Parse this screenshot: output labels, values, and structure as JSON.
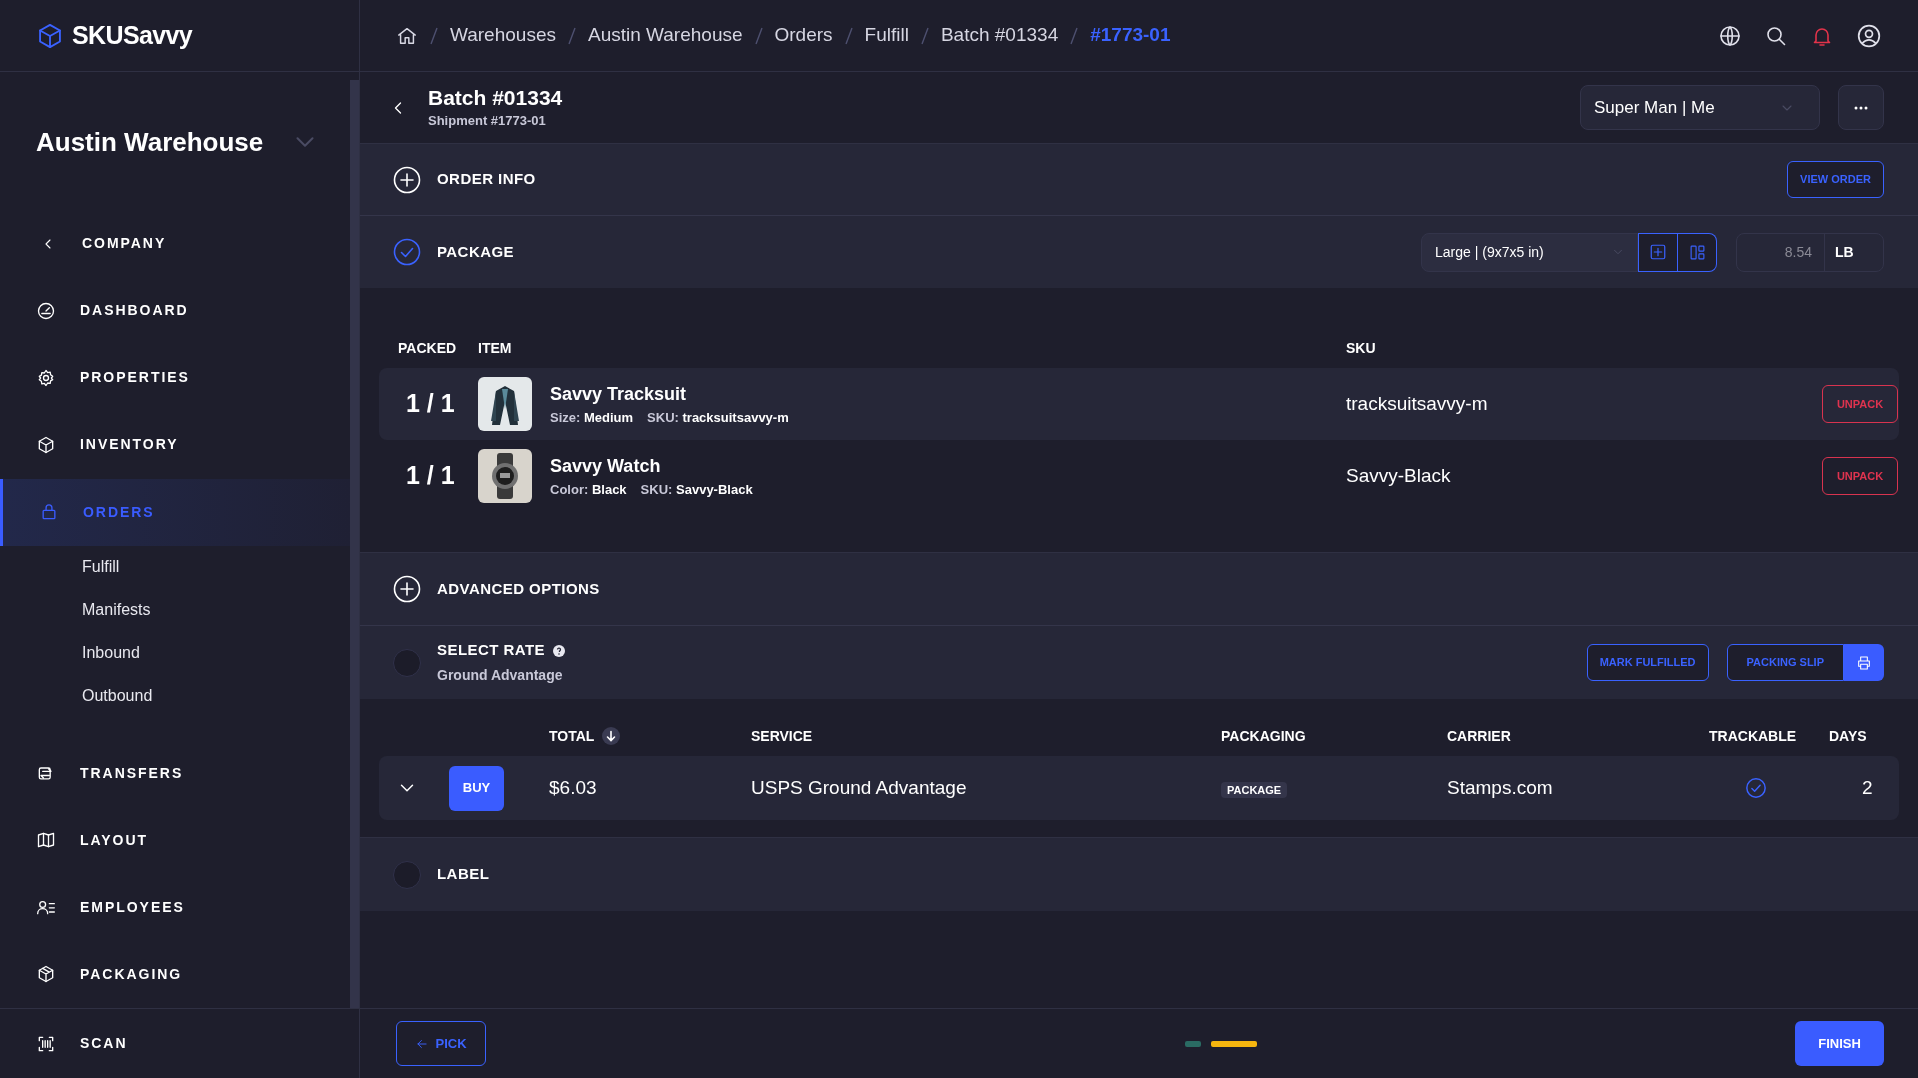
{
  "logo": {
    "text": "SKUSavvy"
  },
  "breadcrumbs": [
    {
      "label": "Warehouses",
      "current": false
    },
    {
      "label": "Austin Warehouse",
      "current": false
    },
    {
      "label": "Orders",
      "current": false
    },
    {
      "label": "Fulfill",
      "current": false
    },
    {
      "label": "Batch #01334",
      "current": false
    },
    {
      "label": "#1773-01",
      "current": true
    }
  ],
  "sidebar": {
    "warehouse": "Austin Warehouse",
    "back_item": "COMPANY",
    "items": [
      {
        "label": "DASHBOARD",
        "selected": false
      },
      {
        "label": "PROPERTIES",
        "selected": false
      },
      {
        "label": "INVENTORY",
        "selected": false
      },
      {
        "label": "ORDERS",
        "selected": true,
        "children": [
          {
            "label": "Fulfill",
            "selected": false
          },
          {
            "label": "Manifests",
            "selected": false
          },
          {
            "label": "Inbound",
            "selected": false
          },
          {
            "label": "Outbound",
            "selected": false
          }
        ]
      },
      {
        "label": "TRANSFERS",
        "selected": false
      },
      {
        "label": "LAYOUT",
        "selected": false
      },
      {
        "label": "EMPLOYEES",
        "selected": false
      },
      {
        "label": "PACKAGING",
        "selected": false
      }
    ],
    "bottom_item": "SCAN"
  },
  "page": {
    "title": "Batch #01334",
    "subtitle": "Shipment #1773-01",
    "user_select": "Super Man | Me"
  },
  "order_info": {
    "title": "ORDER INFO",
    "expanded": false,
    "button": "VIEW ORDER"
  },
  "package": {
    "title": "PACKAGE",
    "done": true,
    "box_select": "Large | (9x7x5 in)",
    "weight": "8.54",
    "unit": "LB"
  },
  "items_table": {
    "columns": [
      "PACKED",
      "ITEM",
      "SKU"
    ],
    "rows": [
      {
        "packed": "1 / 1",
        "name": "Savvy Tracksuit",
        "attributes": [
          {
            "label": "Size:",
            "value": "Medium"
          },
          {
            "label": "SKU:",
            "value": "tracksuitsavvy-m"
          }
        ],
        "sku": "tracksuitsavvy-m",
        "action": "UNPACK",
        "highlighted": true
      },
      {
        "packed": "1 / 1",
        "name": "Savvy Watch",
        "attributes": [
          {
            "label": "Color:",
            "value": "Black"
          },
          {
            "label": "SKU:",
            "value": "Savvy-Black"
          }
        ],
        "sku": "Savvy-Black",
        "action": "UNPACK",
        "highlighted": false
      }
    ]
  },
  "advanced_options": {
    "title": "ADVANCED OPTIONS",
    "expanded": false
  },
  "select_rate": {
    "title": "SELECT RATE",
    "subtitle": "Ground Advantage",
    "checked": false,
    "buttons": [
      "MARK FULFILLED",
      "PACKING SLIP"
    ]
  },
  "rates_table": {
    "columns": [
      {
        "label": "TOTAL",
        "sorted": true
      },
      {
        "label": "SERVICE",
        "sorted": false
      },
      {
        "label": "PACKAGING",
        "sorted": false
      },
      {
        "label": "CARRIER",
        "sorted": false
      },
      {
        "label": "TRACKABLE",
        "sorted": false
      },
      {
        "label": "DAYS",
        "sorted": false
      }
    ],
    "rows": [
      {
        "expanded": false,
        "buy": "BUY",
        "total": "$6.03",
        "service": "USPS Ground Advantage",
        "packaging": "PACKAGE",
        "carrier": "Stamps.com",
        "trackable": true,
        "days": "2"
      }
    ]
  },
  "label": {
    "title": "LABEL",
    "checked": false
  },
  "footer": {
    "back": "PICK",
    "finish": "FINISH",
    "steps": [
      {
        "color": "#2a6b63",
        "selected": false
      },
      {
        "color": "#f5b50f",
        "selected": true
      }
    ]
  }
}
